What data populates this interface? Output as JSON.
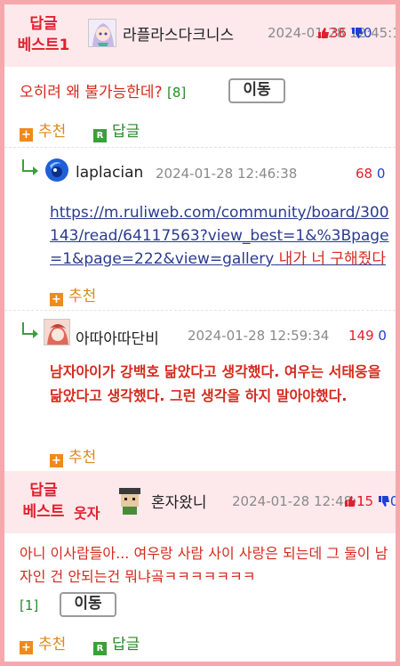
{
  "comment1": {
    "badge_line1": "답글",
    "badge_line2": "베스트1",
    "nick": "라플라스다크니스",
    "date": "2024-01-28 12:45:1",
    "likes": "36",
    "dislikes": "0",
    "text": "오히려 왜 불가능한데?",
    "count": "[8]",
    "move_label": "이동",
    "recommend_label": "추천",
    "reply_label": "답글"
  },
  "reply1": {
    "nick": "laplacian",
    "date": "2024-01-28 12:46:38",
    "likes": "68",
    "dislikes": "0",
    "link": "https://m.ruliweb.com/community/board/300143/read/64117563?view_best=1&%3Bpage=1&page=222&view=gallery",
    "note": " 내가 너 구해줬다",
    "recommend_label": "추천"
  },
  "reply2": {
    "nick": "아따아따단비",
    "date": "2024-01-28 12:59:34",
    "likes": "149",
    "dislikes": "0",
    "text": "남자아이가 강백호 닮았다고 생각했다. 여우는 서태웅을 닮았다고 생각했다. 그런 생각을 하지 말아야했다.",
    "recommend_label": "추천"
  },
  "comment2": {
    "badge_line1": "답글",
    "badge_line2": "베스트",
    "badge_extra": "웃자",
    "nick": "혼자왔니",
    "date": "2024-01-28 12:48:1",
    "likes": "15",
    "dislikes": "0",
    "text": "아니 이사람들아... 여우랑 사람 사이 사랑은 되는데 그 둘이 남자인 건 안되는건 뭐냐곸ㅋㅋㅋㅋㅋㅋㅋ",
    "count": "[1]",
    "move_label": "이동",
    "recommend_label": "추천",
    "reply_label": "답글"
  }
}
